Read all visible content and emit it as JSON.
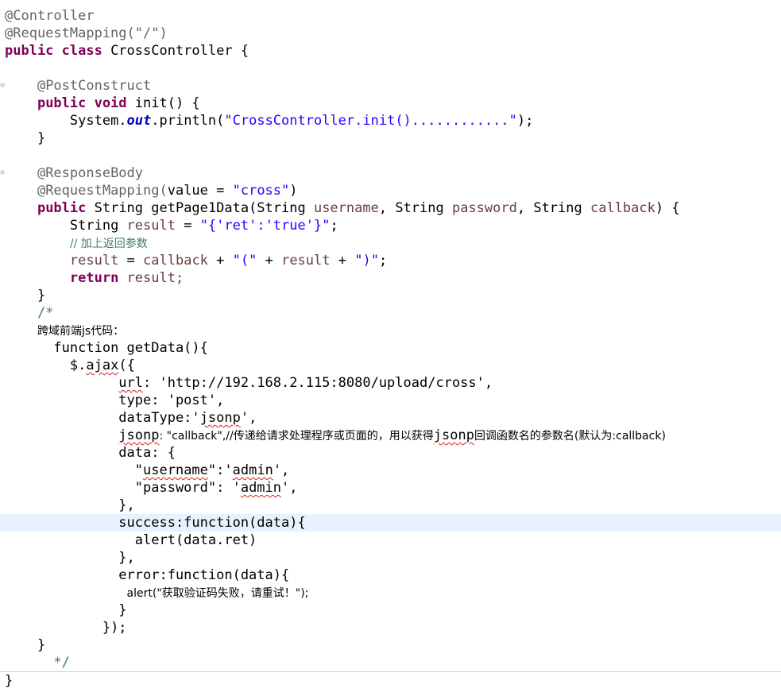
{
  "code": {
    "t_controller": "@Controller",
    "t_reqmap_root": "@RequestMapping(\"/\")",
    "t_class_kw": "public class ",
    "t_class_name": "CrossController {",
    "t_postconstruct": "@PostConstruct",
    "t_init_kw": "public void ",
    "t_init_name": "init() {",
    "t_sys": "System.",
    "t_out": "out",
    "t_println": ".println(",
    "t_init_str": "\"CrossController.init()............\"",
    "t_close_stmt": ");",
    "t_brace_close": "}",
    "t_respbody": "@ResponseBody",
    "t_reqmap_cross_pre": "@RequestMapping(",
    "t_reqmap_cross_mid": "value = ",
    "t_reqmap_cross_str": "\"cross\"",
    "t_paren_close": ")",
    "t_public": "public",
    "t_method_sig": " String getPage1Data(String ",
    "t_param_username": "username",
    "t_comma_string": ", String ",
    "t_param_password": "password",
    "t_param_callback": "callback",
    "t_sig_end": ") {",
    "t_string_type": "String ",
    "t_result": "result",
    "t_eq": " = ",
    "t_result_str": "\"{'ret':'true'}\"",
    "t_semicolon": ";",
    "t_comment_add": "// 加上返回参数",
    "t_cb": "callback",
    "t_plus": " + ",
    "t_lparen_str": "\"(\"",
    "t_rparen_str": "\")\"",
    "t_return": "return",
    "t_return_rest": " result;",
    "t_comment_open": "/*",
    "c_js_title": "跨域前端js代码：",
    "c_func": "function getData(){",
    "c_ajax_pre": "$.",
    "c_ajax": "ajax",
    "c_ajax_post": "({",
    "c_url_key": "url",
    "c_url_val": ": 'http://192.168.2.115:8080/upload/cross',",
    "c_type": "type: 'post',",
    "c_datatype_pre": "dataType:'",
    "c_jsonp": "jsonp",
    "c_datatype_post": "',",
    "c_jsonp_post": ": \"callback\",//传递给请求处理程序或页面的，用以获得",
    "c_jsonp_tail": "回调函数名的参数名(默认为:callback)",
    "c_data_open": "data: {",
    "c_username_pre": "\"",
    "c_username": "username",
    "c_username_mid": "\":'",
    "c_admin": "admin",
    "c_username_end": "',",
    "c_password_pre": "\"password\": '",
    "c_password_end": "',",
    "c_data_close": "},",
    "c_success": "success:function(data){",
    "c_alert_ret": "alert(data.ret)",
    "c_success_close": "},",
    "c_error": "error:function(data){",
    "c_alert_err": "alert(\"获取验证码失败，请重试！\");",
    "c_inner_close": "}",
    "c_ajax_close": "});",
    "c_func_close": "}",
    "c_comment_close": "*/",
    "t_final_brace": "}"
  }
}
